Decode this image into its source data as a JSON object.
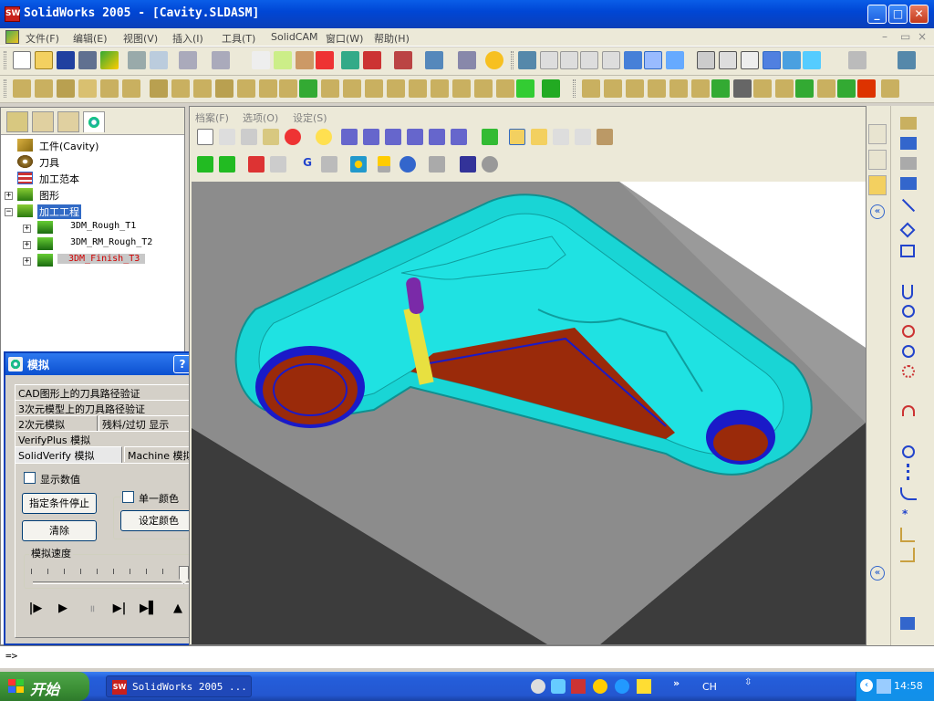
{
  "window": {
    "title": "SolidWorks 2005 - [Cavity.SLDASM]",
    "app_icon_text": "SW"
  },
  "menu": {
    "items": [
      "文件(F)",
      "编辑(E)",
      "视图(V)",
      "插入(I)",
      "工具(T)",
      "SolidCAM",
      "窗口(W)",
      "帮助(H)"
    ]
  },
  "tree": {
    "nodes": [
      {
        "label": "工件(Cavity)"
      },
      {
        "label": "刀具"
      },
      {
        "label": "加工范本"
      },
      {
        "label": "图形"
      },
      {
        "label": "加工工程"
      },
      {
        "label": "3DM_Rough_T1"
      },
      {
        "label": "3DM_RM_Rough_T2"
      },
      {
        "label": "3DM_Finish_T3"
      }
    ]
  },
  "sim_dialog": {
    "title": "模拟",
    "tabs": {
      "row1": "CAD图形上的刀具路径验证",
      "row2": "3次元模型上的刀具路径验证",
      "row3a": "2次元模拟",
      "row3b": "残料/过切 显示",
      "row4": "VerifyPlus 模拟",
      "row5a": "SolidVerify 模拟",
      "row5b": "Machine 模拟"
    },
    "show_values": "显示数值",
    "stop_condition": "指定条件停止",
    "clear": "清除",
    "single_color": "单一颜色",
    "set_color": "设定颜色",
    "speed_label": "模拟速度"
  },
  "viewport": {
    "menu": [
      "档案(F)",
      "选项(O)",
      "设定(S)"
    ]
  },
  "cmdline": {
    "prompt": "=>"
  },
  "taskbar": {
    "start": "开始",
    "task_label": "SolidWorks 2005 ...",
    "lang": "CH",
    "clock": "14:58"
  },
  "colors": {
    "cyan": "#19d5d5",
    "blue": "#1a1ac8",
    "brown": "#9a2a0a",
    "floor": "#8c8c8c",
    "block": "#3c3c3c",
    "selection": "#316ac5"
  }
}
